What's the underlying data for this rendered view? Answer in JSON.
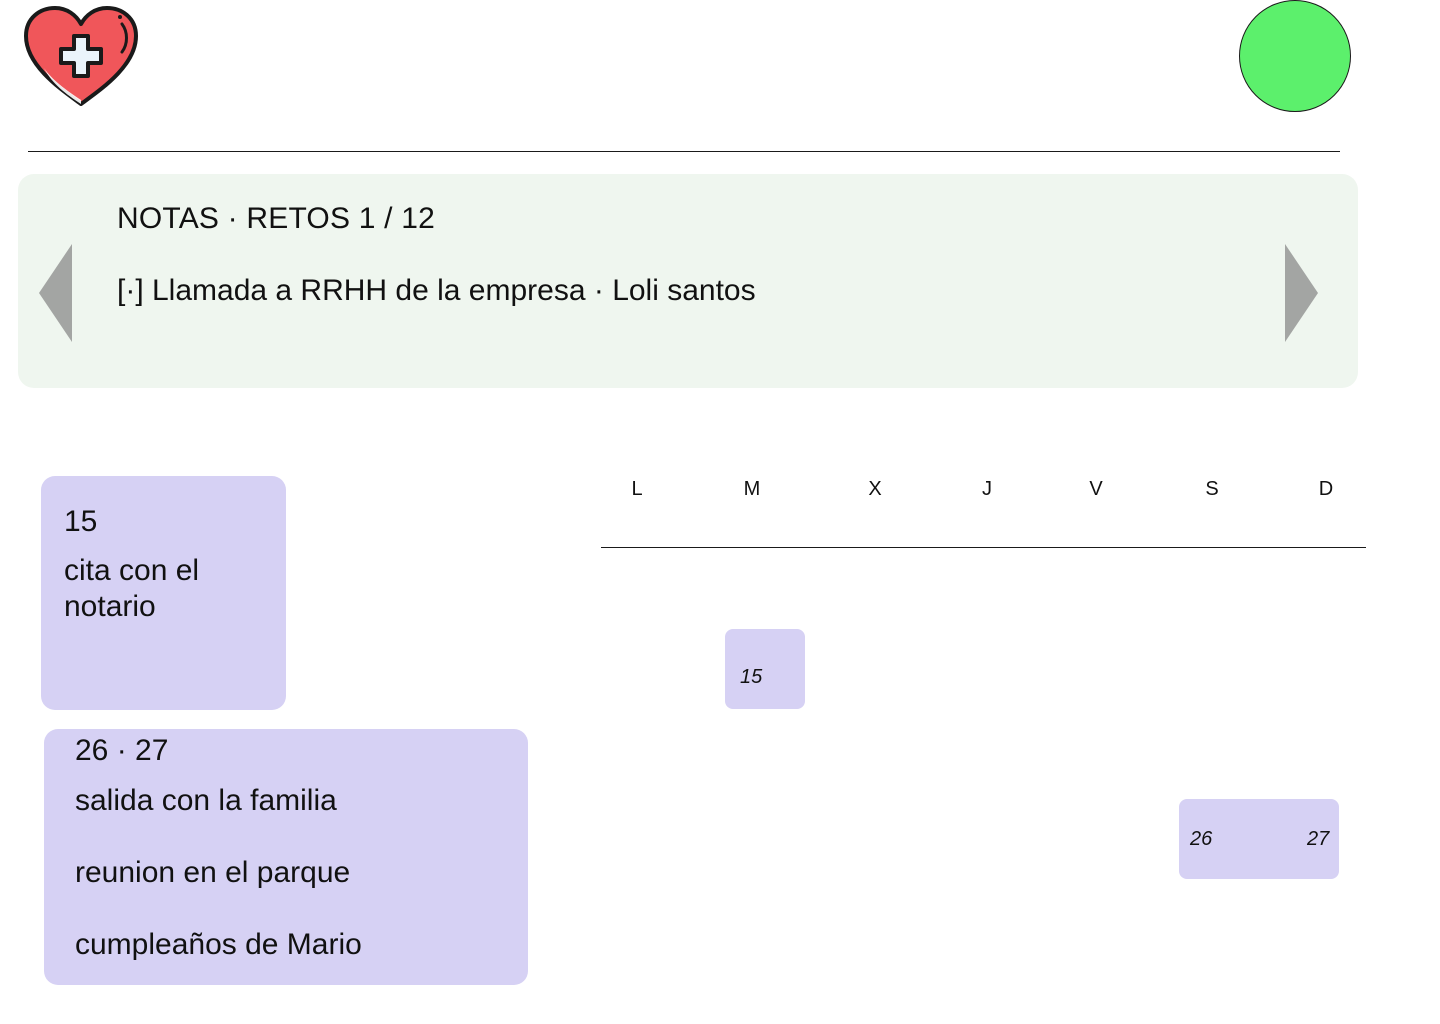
{
  "header": {
    "logo_icon": "heart-medical-cross-icon",
    "avatar_color": "#5cf06c"
  },
  "colors": {
    "notes_bg": "#eff6ef",
    "arrow": "#a3a5a3",
    "event_bg": "#d6d1f4",
    "logo_red": "#f0565a",
    "logo_cross": "#eaf4fb"
  },
  "notes": {
    "title": "NOTAS · RETOS 1 / 12",
    "body": "[·] Llamada a RRHH de la empresa · Loli santos",
    "prev_icon": "triangle-left-icon",
    "next_icon": "triangle-right-icon"
  },
  "event_cards": [
    {
      "date": "15",
      "items": [
        "cita con el notario"
      ]
    },
    {
      "date": "26 · 27",
      "items": [
        "salida con la familia",
        "reunion en el parque",
        "cumpleaños de Mario"
      ]
    }
  ],
  "calendar": {
    "days": [
      "L",
      "M",
      "X",
      "J",
      "V",
      "S",
      "D"
    ],
    "events": [
      {
        "labels": [
          "15"
        ],
        "weekday": "M"
      },
      {
        "labels": [
          "26",
          "27"
        ],
        "weekdays": [
          "S",
          "D"
        ]
      }
    ]
  }
}
